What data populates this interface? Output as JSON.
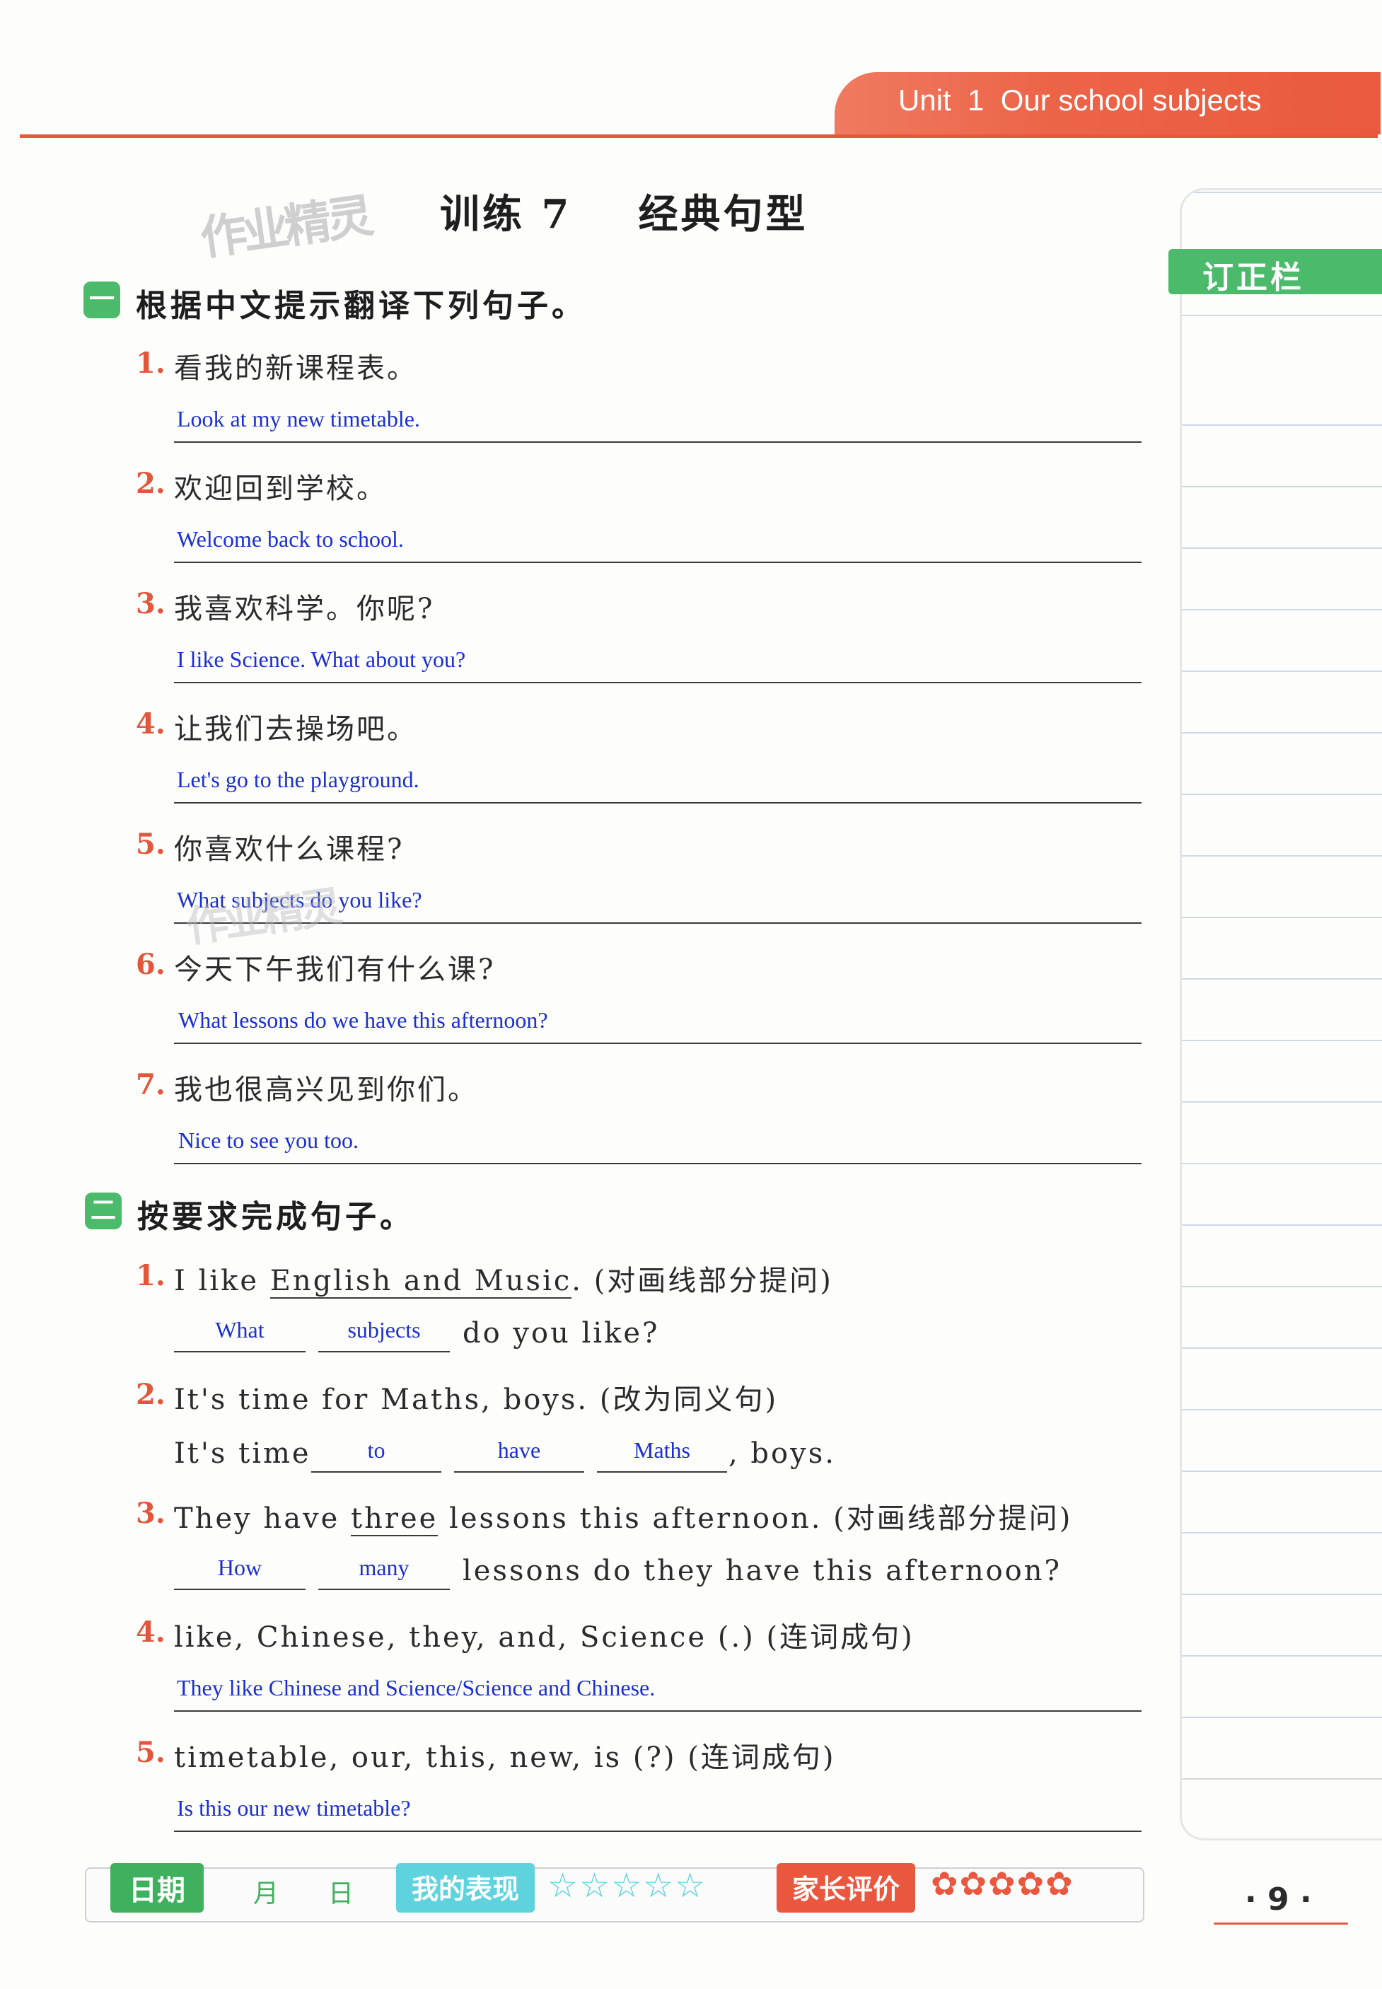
{
  "header": {
    "unit_title": "Unit  1  Our school subjects"
  },
  "watermark": "作业精灵",
  "page_title": "训练 7    经典句型",
  "side_panel": {
    "label": "订正栏"
  },
  "section1": {
    "badge": "一",
    "title": "根据中文提示翻译下列句子。",
    "items": [
      {
        "num": "1.",
        "prompt": "看我的新课程表。",
        "answer": "Look at my new timetable."
      },
      {
        "num": "2.",
        "prompt": "欢迎回到学校。",
        "answer": "Welcome back to school."
      },
      {
        "num": "3.",
        "prompt": "我喜欢科学。你呢?",
        "answer": "I like Science. What about you?"
      },
      {
        "num": "4.",
        "prompt": "让我们去操场吧。",
        "answer": "Let's go to the playground."
      },
      {
        "num": "5.",
        "prompt": "你喜欢什么课程?",
        "answer": "What subjects do you like?"
      },
      {
        "num": "6.",
        "prompt": "今天下午我们有什么课?",
        "answer": "What lessons do we have this afternoon?"
      },
      {
        "num": "7.",
        "prompt": "我也很高兴见到你们。",
        "answer": "Nice to see you too."
      }
    ]
  },
  "section2": {
    "badge": "二",
    "title": "按要求完成句子。",
    "q1": {
      "num": "1.",
      "pre": "I like ",
      "underlined": "English and Music",
      "post": ". (对画线部分提问)",
      "blanks": [
        "What",
        "subjects"
      ],
      "tail": "do you like?"
    },
    "q2": {
      "num": "2.",
      "prompt": "It's time for Maths, boys. (改为同义句)",
      "lead": "It's time",
      "blanks": [
        "to",
        "have",
        "Maths"
      ],
      "tail": ", boys."
    },
    "q3": {
      "num": "3.",
      "pre": "They have ",
      "underlined": "three",
      "post": " lessons this afternoon. (对画线部分提问)",
      "blanks": [
        "How",
        "many"
      ],
      "tail": "lessons do they have this afternoon?"
    },
    "q4": {
      "num": "4.",
      "prompt": "like, Chinese, they, and, Science (.) (连词成句)",
      "answer": "They like Chinese and Science/Science and Chinese."
    },
    "q5": {
      "num": "5.",
      "prompt": "timetable, our, this, new, is (?) (连词成句)",
      "answer": "Is this our new timetable?"
    }
  },
  "footer": {
    "date_label": "日期",
    "month": "月",
    "day": "日",
    "performance_label": "我的表现",
    "stars": "☆☆☆☆☆",
    "parent_label": "家长评价",
    "flowers": "✿✿✿✿✿"
  },
  "page_number": "· 9 ·"
}
